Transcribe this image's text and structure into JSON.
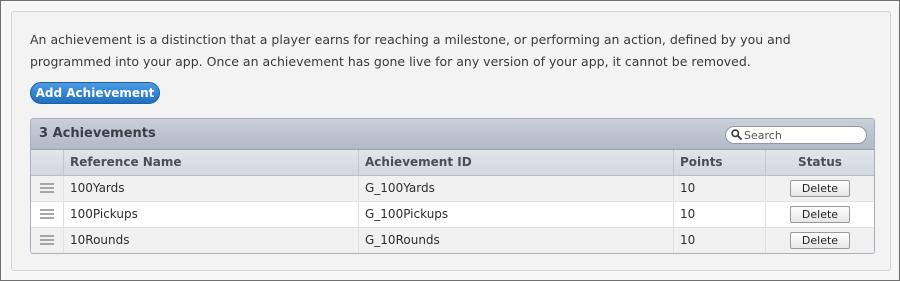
{
  "intro_text": "An achievement is a distinction that a player earns for reaching a milestone, or performing an action, defined by you and programmed into your app. Once an achievement has gone live for any version of your app, it cannot be removed.",
  "add_button_label": "Add Achievement",
  "table": {
    "count_label": "3 Achievements",
    "search": {
      "placeholder": "Search",
      "value": ""
    },
    "columns": [
      "Reference Name",
      "Achievement ID",
      "Points",
      "Status"
    ],
    "rows": [
      {
        "reference_name": "100Yards",
        "achievement_id": "G_100Yards",
        "points": "10",
        "action_label": "Delete"
      },
      {
        "reference_name": "100Pickups",
        "achievement_id": "G_100Pickups",
        "points": "10",
        "action_label": "Delete"
      },
      {
        "reference_name": "10Rounds",
        "achievement_id": "G_10Rounds",
        "points": "10",
        "action_label": "Delete"
      }
    ]
  },
  "colors": {
    "primary_button": "#1f6fc2",
    "table_header": "#b9c1cc",
    "panel_background": "#f3f3f3"
  }
}
